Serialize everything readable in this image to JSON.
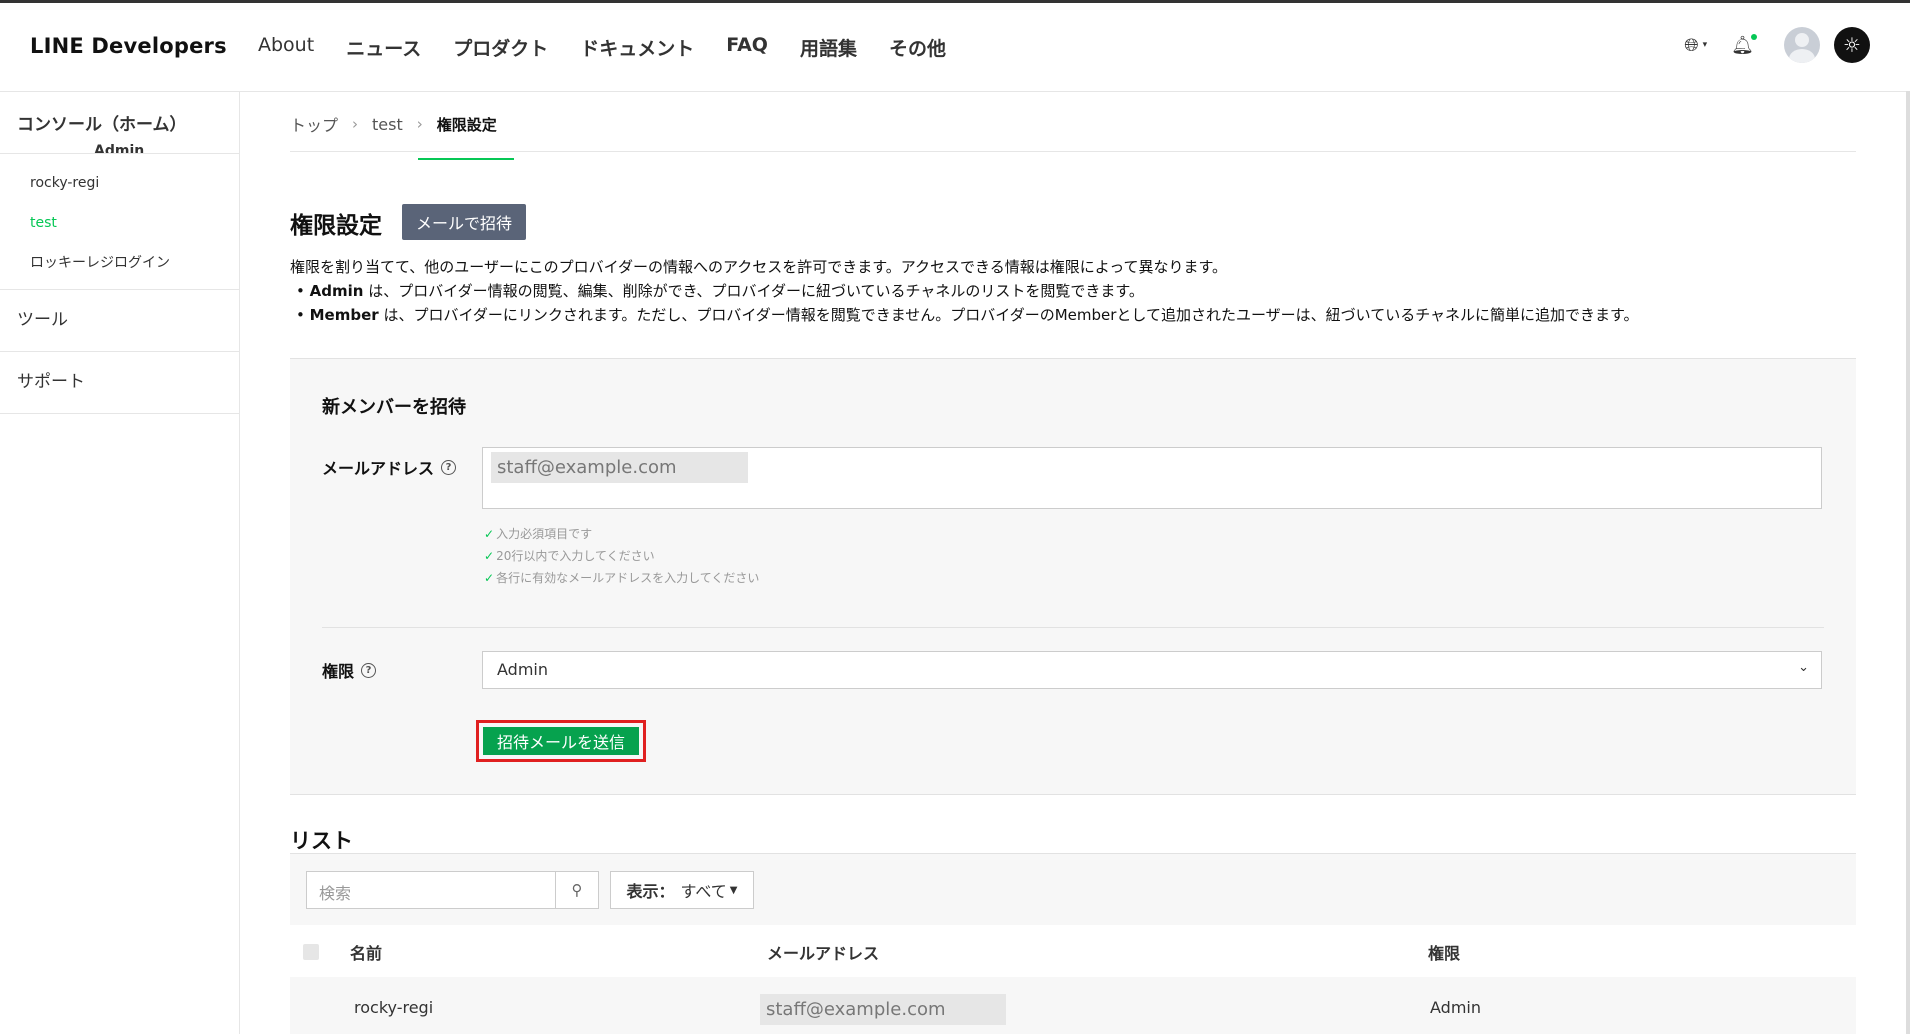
{
  "header": {
    "logo": "LINE Developers",
    "nav": [
      "About",
      "ニュース",
      "プロダクト",
      "ドキュメント",
      "FAQ",
      "用語集",
      "その他"
    ]
  },
  "sidebar": {
    "title": "コンソール（ホーム）",
    "clipped_label": "Admin",
    "items": [
      {
        "label": "rocky-regi",
        "active": false
      },
      {
        "label": "test",
        "active": true
      },
      {
        "label": "ロッキーレジログイン",
        "active": false
      }
    ],
    "sections": [
      "ツール",
      "サポート"
    ]
  },
  "breadcrumb": [
    "トップ",
    "test",
    "権限設定"
  ],
  "page": {
    "title": "権限設定",
    "invite_button": "メールで招待",
    "description": {
      "intro": "権限を割り当てて、他のユーザーにこのプロバイダーの情報へのアクセスを許可できます。アクセスできる情報は権限によって異なります。",
      "admin_term": "Admin",
      "admin_text": " は、プロバイダー情報の閲覧、編集、削除ができ、プロバイダーに紐づいているチャネルのリストを閲覧できます。",
      "member_term": "Member",
      "member_text": " は、プロバイダーにリンクされます。ただし、プロバイダー情報を閲覧できません。プロバイダーのMemberとして追加されたユーザーは、紐づいているチャネルに簡単に追加できます。"
    }
  },
  "invite_form": {
    "title": "新メンバーを招待",
    "email_label": "メールアドレス",
    "email_value": "staff@example.com",
    "checks": [
      "入力必須項目です",
      "20行以内で入力してください",
      "各行に有効なメールアドレスを入力してください"
    ],
    "role_label": "権限",
    "role_value": "Admin",
    "send_button": "招待メールを送信"
  },
  "list": {
    "title": "リスト",
    "search_placeholder": "検索",
    "filter_label": "表示：",
    "filter_value": "すべて",
    "columns": [
      "名前",
      "メールアドレス",
      "権限"
    ],
    "rows": [
      {
        "name": "rocky-regi",
        "email": "staff@example.com",
        "role": "Admin"
      }
    ]
  },
  "colors": {
    "accent": "#06c755",
    "send_button": "#06a24e",
    "highlight_border": "#e02020",
    "invite_button": "#5a6478"
  }
}
